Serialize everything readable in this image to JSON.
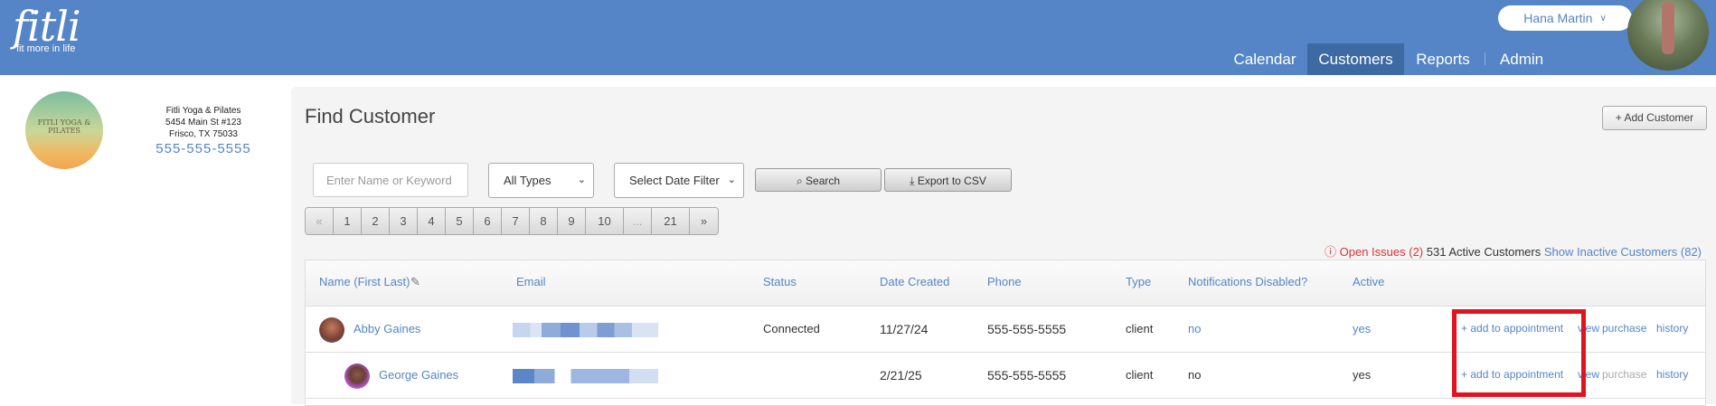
{
  "brand": {
    "name": "fitli",
    "tagline": "fit more in life"
  },
  "user": {
    "name": "Hana Martin"
  },
  "nav": [
    "Calendar",
    "Customers",
    "Reports",
    "Admin"
  ],
  "studio": {
    "name": "Fitli Yoga & Pilates",
    "address1": "5454 Main St #123",
    "address2": "Frisco, TX 75033",
    "phone": "555-555-5555",
    "logo_text": "FITLI YOGA & PILATES"
  },
  "page": {
    "title": "Find Customer",
    "add_button": "+ Add Customer"
  },
  "filters": {
    "search_placeholder": "Enter Name or Keyword",
    "type_select": "All Types",
    "date_select": "Select Date Filter",
    "search_button": "Search",
    "export_button": "Export to CSV"
  },
  "pagination": [
    "«",
    "1",
    "2",
    "3",
    "4",
    "5",
    "6",
    "7",
    "8",
    "9",
    "10",
    "...",
    "21",
    "»"
  ],
  "summary": {
    "open_issues": "Open Issues (2)",
    "active_count": "531",
    "active_label": "Active Customers",
    "inactive_link": "Show Inactive Customers (82)"
  },
  "table": {
    "headers": [
      "Name (First Last)",
      "Email",
      "Status",
      "Date Created",
      "Phone",
      "Type",
      "Notifications Disabled?",
      "Active"
    ],
    "rows": [
      {
        "name": "Abby Gaines",
        "status": "Connected",
        "date": "11/27/24",
        "phone": "555-555-5555",
        "type": "client",
        "notifications": "no",
        "active": "yes",
        "action_add": "+ add to appointment",
        "action_view": "view",
        "action_purchase": "purchase",
        "action_history": "history"
      },
      {
        "name": "George Gaines",
        "status": "",
        "date": "2/21/25",
        "phone": "555-555-5555",
        "type": "client",
        "notifications": "no",
        "active": "yes",
        "action_add": "+ add to appointment",
        "action_view": "view",
        "action_purchase": "purchase",
        "action_history": "history"
      }
    ]
  },
  "colors": {
    "brand": "#5585c6",
    "nav_active": "#3d6aa3",
    "highlight": "#e0141e",
    "issue": "#dd3333"
  }
}
